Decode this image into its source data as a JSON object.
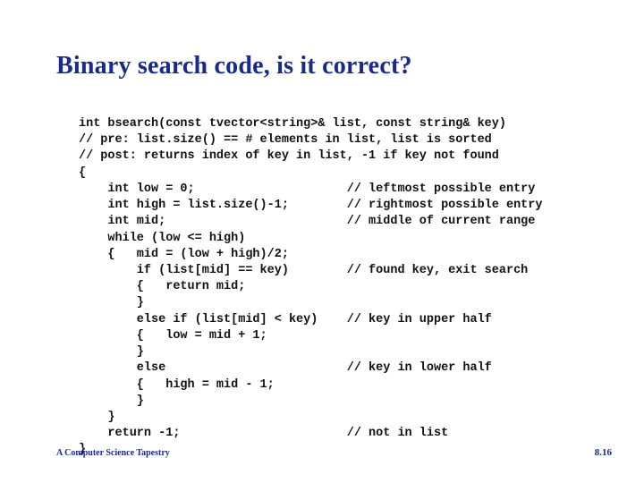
{
  "title": "Binary search code, is it correct?",
  "code": "int bsearch(const tvector<string>& list, const string& key)\n// pre: list.size() == # elements in list, list is sorted\n// post: returns index of key in list, -1 if key not found\n{\n    int low = 0;                     // leftmost possible entry\n    int high = list.size()-1;        // rightmost possible entry\n    int mid;                         // middle of current range\n    while (low <= high)\n    {   mid = (low + high)/2;\n        if (list[mid] == key)        // found key, exit search\n        {   return mid;\n        }\n        else if (list[mid] < key)    // key in upper half\n        {   low = mid + 1;\n        }\n        else                         // key in lower half\n        {   high = mid - 1;\n        }\n    }\n    return -1;                       // not in list\n}",
  "footer": {
    "left": "A Computer Science Tapestry",
    "right": "8.16"
  }
}
